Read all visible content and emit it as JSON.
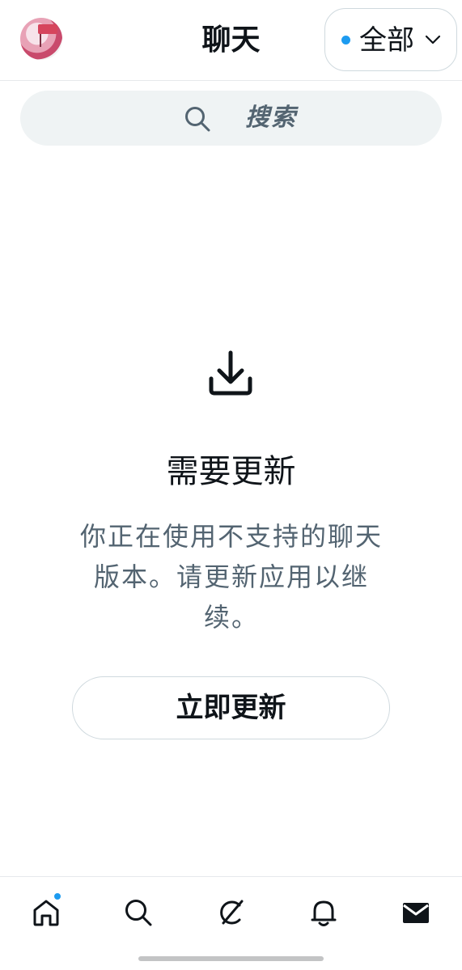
{
  "header": {
    "title": "聊天",
    "filter_label": "全部",
    "filter_dot_color": "#1d9bf0",
    "avatar_icon": "profile-avatar"
  },
  "search": {
    "placeholder": "搜索",
    "icon": "search-icon"
  },
  "empty_state": {
    "icon": "download-icon",
    "heading": "需要更新",
    "description": "你正在使用不支持的聊天版本。请更新应用以继续。",
    "button_label": "立即更新"
  },
  "bottom_nav": {
    "items": [
      {
        "name": "home",
        "icon": "home-icon",
        "has_badge": true
      },
      {
        "name": "search",
        "icon": "search-icon"
      },
      {
        "name": "grok",
        "icon": "grok-icon"
      },
      {
        "name": "notifications",
        "icon": "bell-icon"
      },
      {
        "name": "messages",
        "icon": "mail-icon",
        "active": true
      }
    ]
  },
  "colors": {
    "accent": "#1d9bf0",
    "text_primary": "#0f1419",
    "text_secondary": "#536471",
    "search_bg": "#eff3f4"
  }
}
